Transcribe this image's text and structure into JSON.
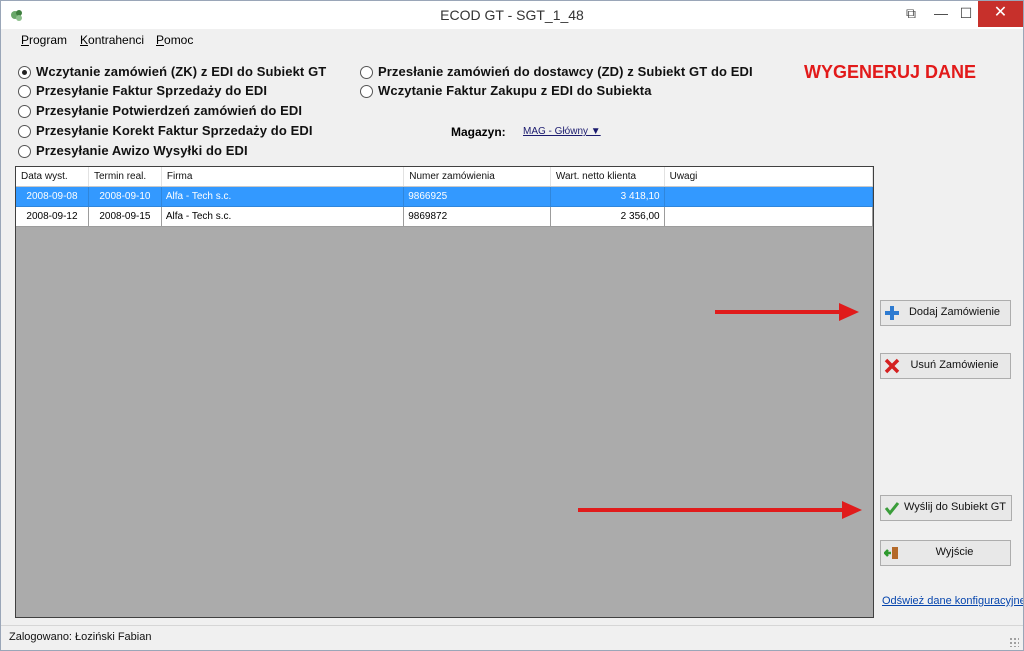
{
  "window": {
    "title": "ECOD GT -  SGT_1_48",
    "controls": {
      "restore": "⧉",
      "minimize": "—",
      "maximize": "☐",
      "close": "✕"
    }
  },
  "menu": [
    "Program",
    "Kontrahenci",
    "Pomoc"
  ],
  "options_left": [
    {
      "label": "Wczytanie zamówień (ZK) z EDI do Subiekt GT",
      "selected": true
    },
    {
      "label": "Przesyłanie Faktur Sprzedaży do EDI",
      "selected": false
    },
    {
      "label": "Przesyłanie Potwierdzeń zamówień do EDI",
      "selected": false
    },
    {
      "label": "Przesyłanie Korekt Faktur Sprzedaży do EDI",
      "selected": false
    },
    {
      "label": "Przesyłanie Awizo Wysyłki do EDI",
      "selected": false
    }
  ],
  "options_right": [
    {
      "label": "Przesłanie zamówień do dostawcy (ZD) z Subiekt GT do EDI",
      "selected": false
    },
    {
      "label": "Wczytanie Faktur Zakupu z EDI do Subiekta",
      "selected": false
    }
  ],
  "generate_label": "WYGENERUJ DANE",
  "magazyn": {
    "label": "Magazyn:",
    "value": "MAG - Główny ▼"
  },
  "table": {
    "columns": [
      "Data wyst.",
      "Termin real.",
      "Firma",
      "Numer zamówienia",
      "Wart. netto klienta",
      "Uwagi"
    ],
    "rows": [
      [
        "2008-09-08",
        "2008-09-10",
        "Alfa - Tech s.c.",
        "9866925",
        "3 418,10",
        ""
      ],
      [
        "2008-09-12",
        "2008-09-15",
        "Alfa - Tech s.c.",
        "9869872",
        "2 356,00",
        ""
      ]
    ],
    "selected_row": 0
  },
  "buttons": {
    "add": "Dodaj Zamówienie",
    "remove": "Usuń Zamówienie",
    "send": "Wyślij do Subiekt GT",
    "exit": "Wyjście"
  },
  "refresh_link": "Odśwież dane konfiguracyjne",
  "status": "Zalogowano: Łoziński Fabian",
  "colors": {
    "accent_red": "#e21a1a",
    "selection_blue": "#3399ff",
    "arrow_red": "#e01b1b"
  }
}
